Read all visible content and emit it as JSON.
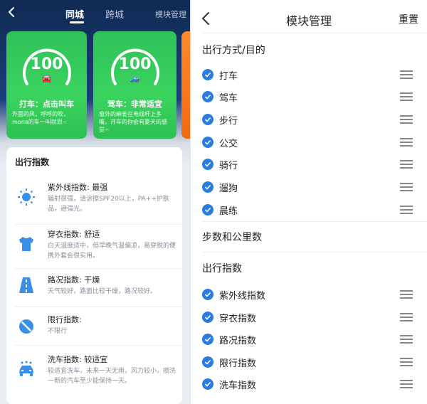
{
  "left": {
    "tabs": [
      {
        "label": "同城",
        "active": true
      },
      {
        "label": "跨城",
        "active": false
      },
      {
        "label": "模块管理",
        "active": false
      }
    ],
    "cards": [
      {
        "score": "100",
        "icon": "car-icon",
        "title": "打车：点击叫车",
        "desc": "外面的风，呼呼的吹，mona的车一叫就到~"
      },
      {
        "score": "100",
        "icon": "steering-car-icon",
        "title": "驾车：非常适宜",
        "desc": "窗外的麻雀在电线杆上多嘴，开车的你会有夏天的感觉~"
      }
    ],
    "panel_title": "出行指数",
    "indices": [
      {
        "icon": "sun-icon",
        "title": "紫外线指数: 最强",
        "desc": "辐射很强，请涂擦SPF20以上，PA++护肤品，避强光。"
      },
      {
        "icon": "shirt-icon",
        "title": "穿衣指数: 舒适",
        "desc": "白天温度适中，但早晚气温偏凉，易穿脱的便携外套会很实用。"
      },
      {
        "icon": "road-icon",
        "title": "路况指数: 干燥",
        "desc": "天气较好，路面比较干燥，路况较好。"
      },
      {
        "icon": "no-entry-icon",
        "title": "限行指数:",
        "desc": "不限行"
      },
      {
        "icon": "car-wash-icon",
        "title": "洗车指数: 较适宜",
        "desc": "较适宜洗车，未来一天无雨，风力较小，擦洗一新的汽车至少能保持一天。"
      }
    ]
  },
  "right": {
    "title": "模块管理",
    "reset": "重置",
    "section1": "出行方式/目的",
    "modes": [
      "打车",
      "驾车",
      "步行",
      "公交",
      "骑行",
      "遛狗",
      "晨练"
    ],
    "section2": "步数和公里数",
    "section3": "出行指数",
    "indices": [
      "紫外线指数",
      "穿衣指数",
      "路况指数",
      "限行指数",
      "洗车指数"
    ]
  },
  "colors": {
    "accent": "#2a7ce0",
    "card_green": "#35c95a",
    "header_navy": "#132f5e"
  }
}
